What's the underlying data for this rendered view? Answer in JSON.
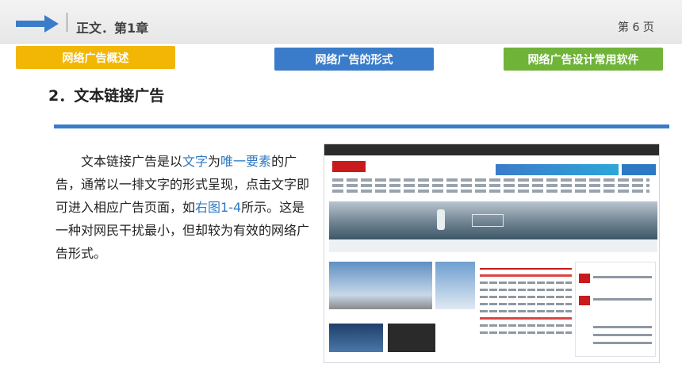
{
  "header": {
    "chapter_title": "正文．第1章",
    "page_number": "第 6 页"
  },
  "tabs": [
    {
      "label": "网络广告概述"
    },
    {
      "label": "网络广告的形式"
    },
    {
      "label": "网络广告设计常用软件"
    }
  ],
  "section_heading": "2．文本链接广告",
  "body": {
    "t1": "文本链接广告是以",
    "h1": "文字",
    "t2": "为",
    "h2": "唯一要素",
    "t3": "的广告，通常以一排文字的形式呈现，点击文字即可进入相应广告页面，如",
    "h3": "右图1-4",
    "t4": "所示。这是一种对网民干扰最小，但却较为有效的网络广告形式。"
  },
  "colors": {
    "accent_blue": "#3a7cc9",
    "tab_yellow": "#f2b705",
    "tab_green": "#6fb338",
    "link_blue": "#2e79c4"
  }
}
